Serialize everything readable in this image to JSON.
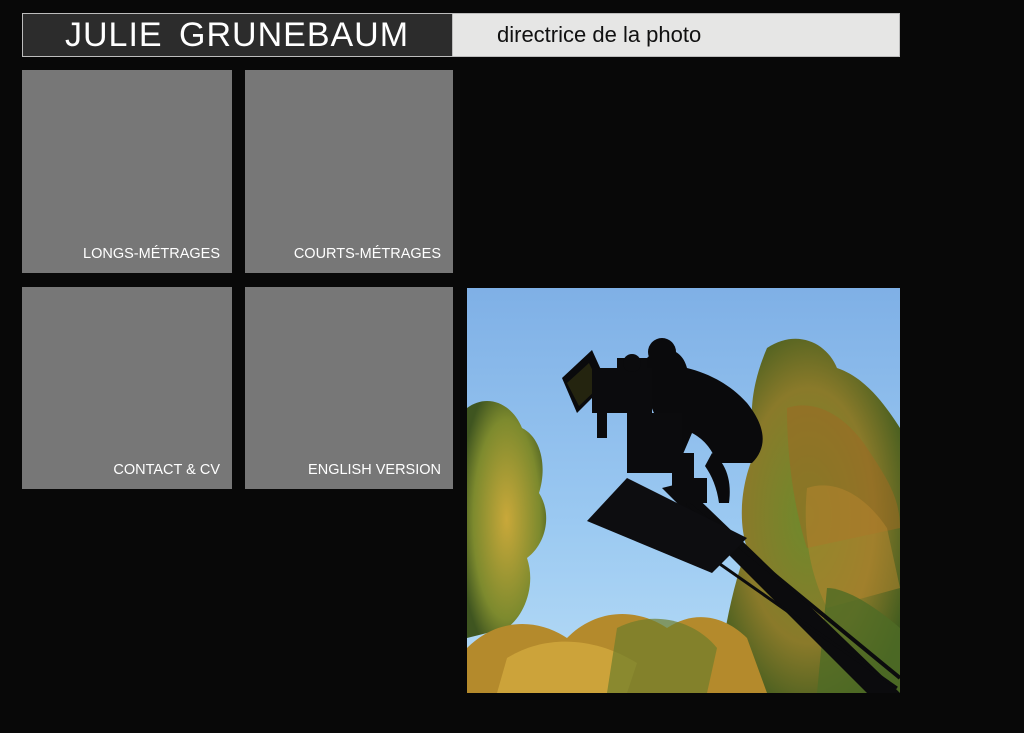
{
  "header": {
    "name": "JULIE GRUNEBAUM",
    "role": "directrice de la photo"
  },
  "nav": {
    "tiles": [
      {
        "label": "LONGS-MÉTRAGES"
      },
      {
        "label": "COURTS-MÉTRAGES"
      },
      {
        "label": "CONTACT & CV"
      },
      {
        "label": "ENGLISH VERSION"
      }
    ]
  },
  "colors": {
    "background": "#080808",
    "tile": "#777777",
    "header_dark": "#2c2c2c",
    "header_light": "#e6e6e5",
    "sky": "#8fbfea"
  }
}
